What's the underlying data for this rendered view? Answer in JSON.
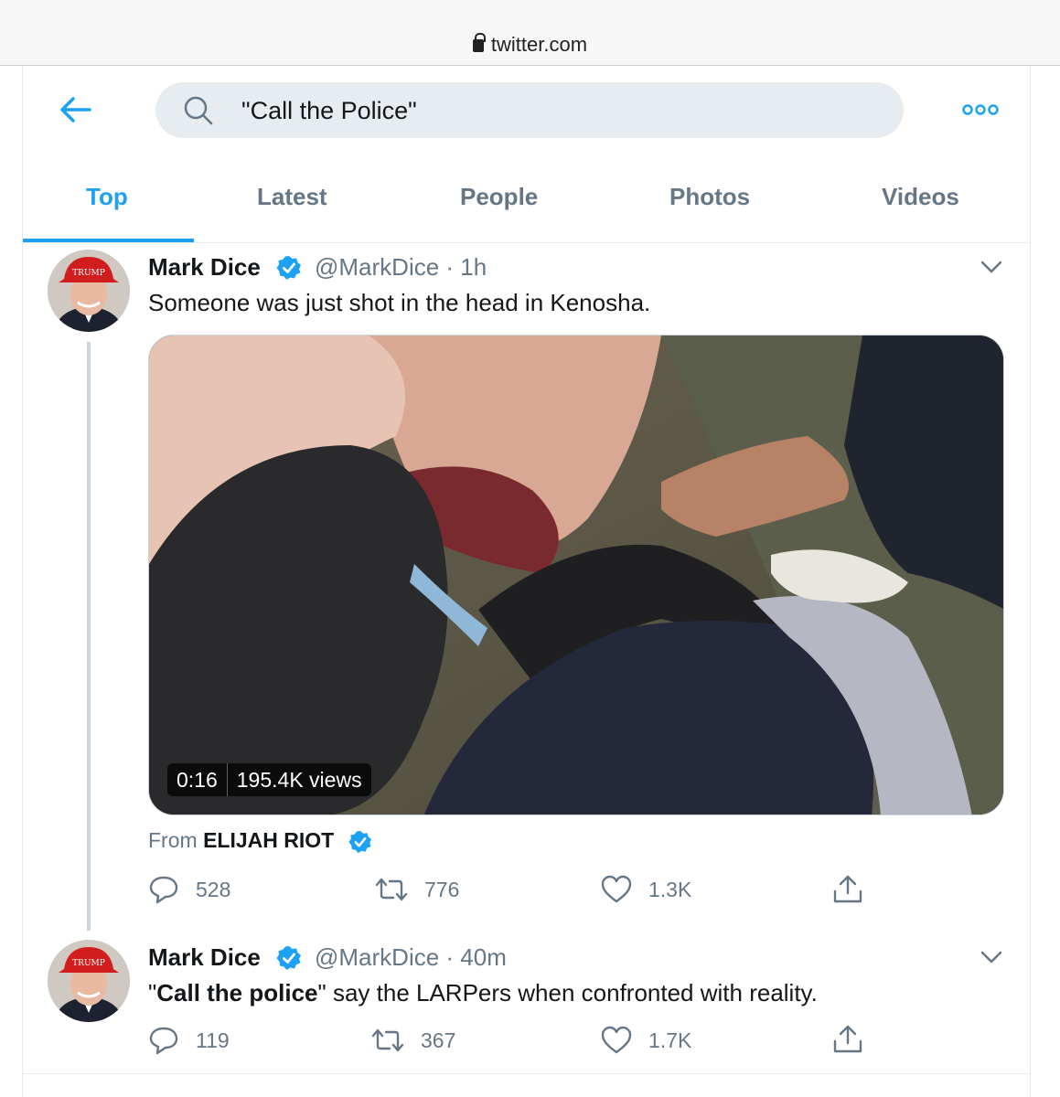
{
  "browser": {
    "url": "twitter.com"
  },
  "search": {
    "query": "\"Call the Police\""
  },
  "tabs": [
    {
      "label": "Top"
    },
    {
      "label": "Latest"
    },
    {
      "label": "People"
    },
    {
      "label": "Photos"
    },
    {
      "label": "Videos"
    }
  ],
  "tweets": [
    {
      "name": "Mark Dice",
      "handle": "@MarkDice · 1h",
      "text": "Someone was just shot in the head in Kenosha.",
      "video": {
        "duration": "0:16",
        "views": "195.4K views"
      },
      "from_label": "From",
      "from_name": "ELIJAH RIOT",
      "replies": "528",
      "retweets": "776",
      "likes": "1.3K"
    },
    {
      "name": "Mark Dice",
      "handle": "@MarkDice · 40m",
      "text_quote_open": "\"",
      "text_bold": "Call the police",
      "text_rest": "\" say the LARPers when confronted with reality.",
      "replies": "119",
      "retweets": "367",
      "likes": "1.7K"
    }
  ],
  "avatar": {
    "hat_text": "TRUMP"
  },
  "colors": {
    "accent": "#1da1f2",
    "secondary_text": "#657786",
    "border": "#e6ecf0"
  }
}
